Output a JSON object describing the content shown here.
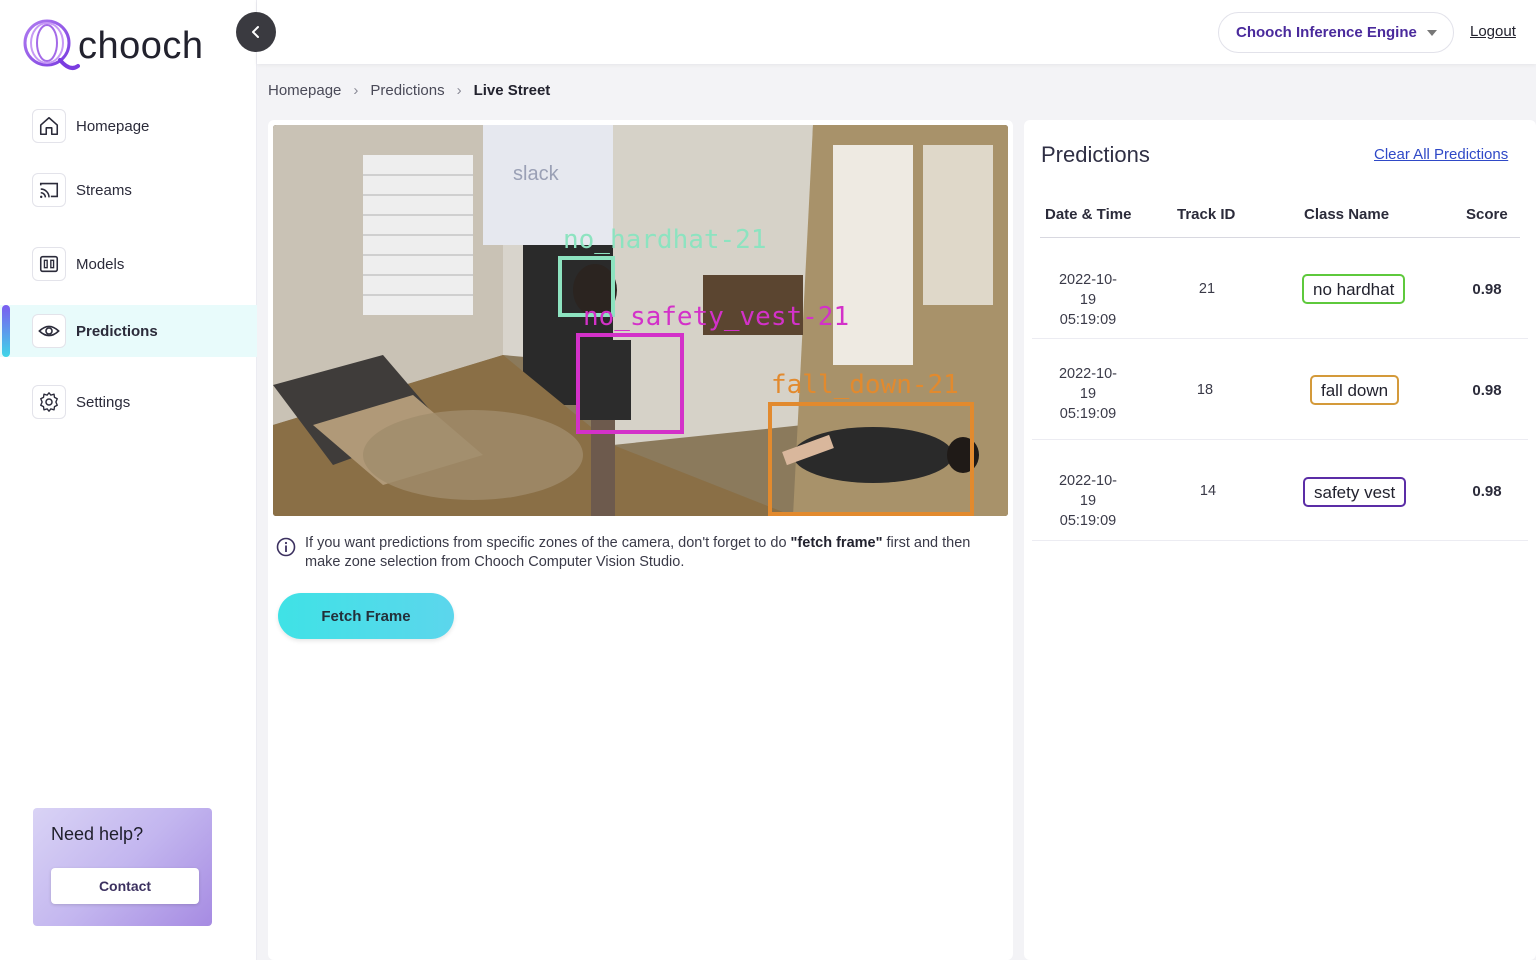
{
  "app": {
    "logo_text": "chooch"
  },
  "sidebar": {
    "items": [
      {
        "label": "Homepage",
        "icon": "home-icon"
      },
      {
        "label": "Streams",
        "icon": "cast-icon"
      },
      {
        "label": "Models",
        "icon": "model-icon"
      },
      {
        "label": "Predictions",
        "icon": "eye-icon",
        "active": true
      },
      {
        "label": "Settings",
        "icon": "gear-icon"
      }
    ],
    "help": {
      "title": "Need help?",
      "button": "Contact"
    }
  },
  "header": {
    "engine": "Chooch Inference Engine",
    "logout": "Logout"
  },
  "breadcrumb": {
    "items": [
      "Homepage",
      "Predictions"
    ],
    "current": "Live Street"
  },
  "video": {
    "labels": [
      "no_hardhat-21",
      "no_safety_vest-21",
      "fall_down-21"
    ],
    "watermark": "slack"
  },
  "info": {
    "text_before": "If you want predictions from specific zones of the camera, don't forget to do ",
    "bold": "\"fetch frame\"",
    "text_after": " first and then make zone selection from Chooch Computer Vision Studio."
  },
  "fetch_button": "Fetch Frame",
  "predictions": {
    "title": "Predictions",
    "clear_label": "Clear All Predictions",
    "columns": [
      "Date & Time",
      "Track ID",
      "Class Name",
      "Score"
    ],
    "rows": [
      {
        "date": "2022-10-19",
        "time": "05:19:09",
        "track_id": "21",
        "class_name": "no hardhat",
        "color": "#5ec93c",
        "score": "0.98"
      },
      {
        "date": "2022-10-19",
        "time": "05:19:09",
        "track_id": "18",
        "class_name": "fall down",
        "color": "#d49a3a",
        "score": "0.98"
      },
      {
        "date": "2022-10-19",
        "time": "05:19:09",
        "track_id": "14",
        "class_name": "safety vest",
        "color": "#5b2da6",
        "score": "0.98"
      }
    ]
  },
  "colors": {
    "accent": "#4a2a9c",
    "active_nav_bg": "#e8fbfb",
    "fetch_button": "#3fe2e6",
    "link": "#2f49c7"
  }
}
